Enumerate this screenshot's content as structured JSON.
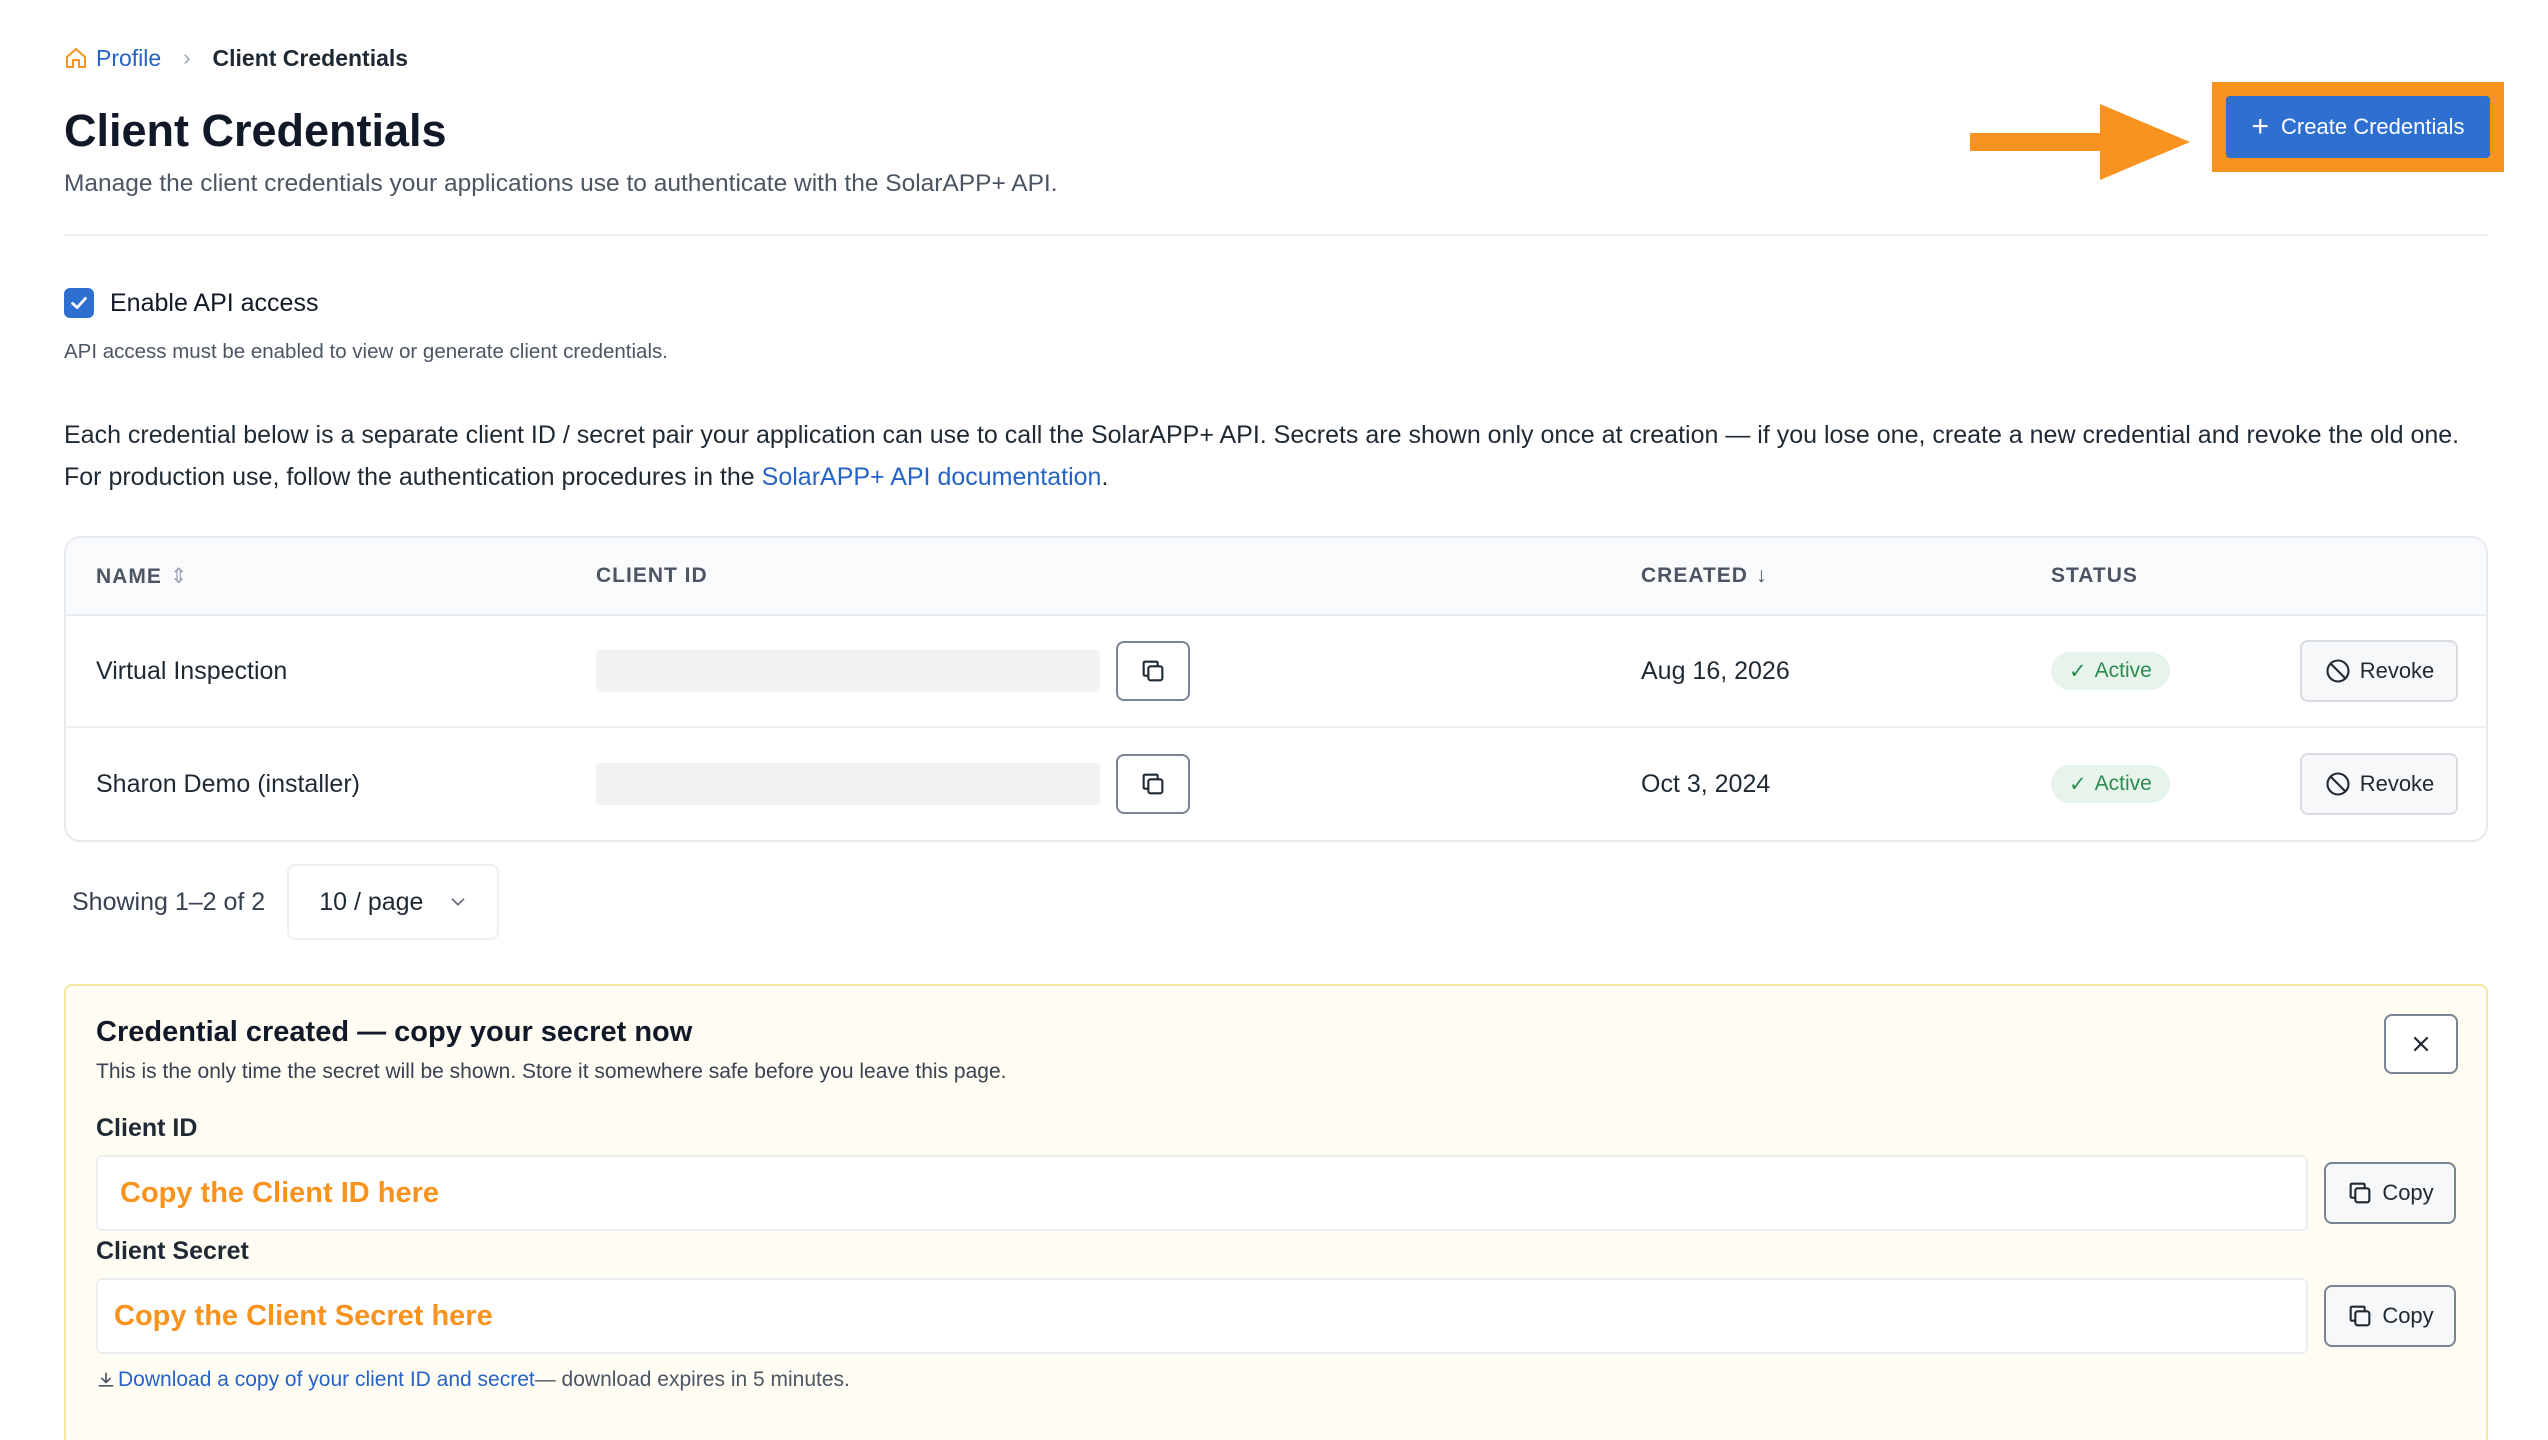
{
  "breadcrumb": {
    "home_label": "Profile",
    "separator": "›",
    "current": "Client Credentials"
  },
  "header": {
    "title": "Client Credentials",
    "subtitle": "Manage the client credentials your applications use to authenticate with the SolarAPP+ API.",
    "create_button_label": "Create Credentials",
    "create_button_icon": "+"
  },
  "api_access": {
    "label": "Enable API access",
    "checked": true,
    "help": "API access must be enabled to view or generate client credentials."
  },
  "intro": {
    "text_before_link": "Each credential below is a separate client ID / secret pair your application can use to call the SolarAPP+ API. Secrets are shown only once at creation — if you lose one, create a new credential and revoke the old one. For production use, follow the authentication procedures in the ",
    "link_text": "SolarAPP+ API documentation",
    "text_after_link": "."
  },
  "table": {
    "headers": {
      "name": "NAME",
      "client_id": "CLIENT ID",
      "created": "CREATED",
      "status": "STATUS"
    },
    "rows": [
      {
        "name": "Virtual Inspection",
        "created": "Aug 16, 2026",
        "status": "Active",
        "action": "Revoke"
      },
      {
        "name": "Sharon Demo (installer)",
        "created": "Oct 3, 2024",
        "status": "Active",
        "action": "Revoke"
      }
    ]
  },
  "pagination": {
    "summary": "Showing 1–2 of 2",
    "page_size": "10 / page"
  },
  "created_panel": {
    "title": "Credential created — copy your secret now",
    "description": "This is the only time the secret will be shown. Store it somewhere safe before you leave this page.",
    "client_id_label": "Client ID",
    "client_id_value": "Copy the Client ID here",
    "client_secret_label": "Client Secret",
    "client_secret_value": "Copy the Client Secret here",
    "copy_label": "Copy",
    "download_link": "Download a copy of your client ID and secret",
    "download_note": " — download expires in 5 minutes."
  },
  "colors": {
    "primary": "#2f6fd0",
    "annotation_orange": "#f7931e",
    "link": "#2563c4",
    "status_active_bg": "#e6f4ec",
    "status_active_text": "#2d8a52"
  },
  "icons": {
    "breadcrumb": "home-icon",
    "checkbox": "check-icon",
    "copy": "copy-icon",
    "revoke": "ban-icon",
    "close": "close-icon",
    "page_size": "chevron-down-icon",
    "download": "download-icon",
    "sort_name": "sort-icon",
    "sort_created": "arrow-down-icon"
  }
}
